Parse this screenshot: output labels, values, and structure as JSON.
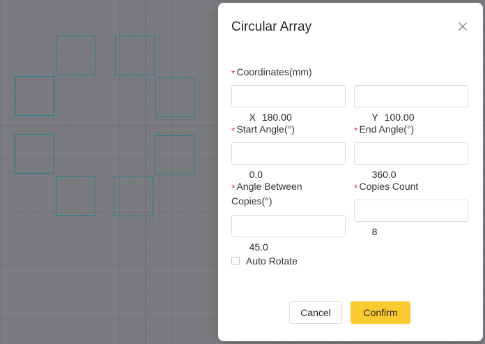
{
  "dialog": {
    "title": "Circular Array",
    "close_icon": "close-icon"
  },
  "fields": {
    "coordinates": {
      "required_mark": "*",
      "label": "Coordinates(mm)",
      "x_prefix": "X",
      "x_value": "180.00",
      "y_prefix": "Y",
      "y_value": "100.00"
    },
    "start_angle": {
      "required_mark": "*",
      "label": "Start Angle(°)",
      "value": "0.0"
    },
    "end_angle": {
      "required_mark": "*",
      "label": "End Angle(°)",
      "value": "360.0"
    },
    "angle_between": {
      "required_mark": "*",
      "label_line1": "Angle Between",
      "label_line2": "Copies(°)",
      "value": "45.0"
    },
    "copies_count": {
      "required_mark": "*",
      "label": "Copies Count",
      "value": "8"
    }
  },
  "auto_rotate": {
    "label": "Auto Rotate",
    "checked": false
  },
  "buttons": {
    "cancel": "Cancel",
    "confirm": "Confirm"
  },
  "colors": {
    "canvas_bg": "#7b7c7f",
    "shape_stroke": "#2b7d8c",
    "required": "#e8403d",
    "confirm_bg": "#fbca2e"
  }
}
